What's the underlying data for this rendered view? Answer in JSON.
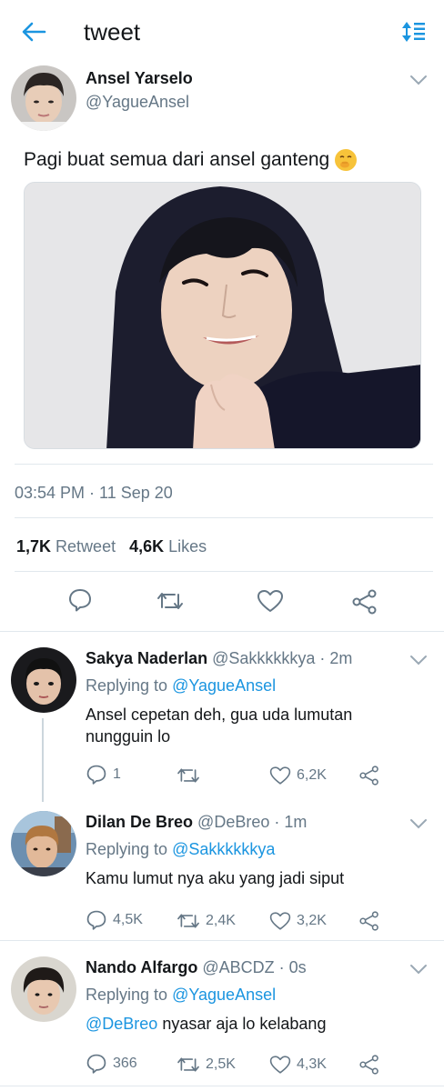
{
  "header": {
    "title": "tweet"
  },
  "main_tweet": {
    "name": "Ansel Yarselo",
    "handle": "@YagueAnsel",
    "text": "Pagi buat semua dari ansel ganteng",
    "timestamp": "03:54 PM · 11 Sep 20",
    "retweets_count": "1,7K",
    "retweets_label": "Retweet",
    "likes_count": "4,6K",
    "likes_label": "Likes"
  },
  "replies": [
    {
      "name": "Sakya Naderlan",
      "handle": "@Sakkkkkkya",
      "time": "· 2m",
      "replying_prefix": "Replying to",
      "replying_to": "@YagueAnsel",
      "text": "Ansel cepetan deh, gua uda lumutan nungguin lo",
      "reply_count": "1",
      "retweet_count": "",
      "like_count": "6,2K"
    },
    {
      "name": "Dilan De Breo",
      "handle": "@DeBreo",
      "time": "· 1m",
      "replying_prefix": "Replying to",
      "replying_to": "@Sakkkkkkya",
      "text": "Kamu lumut nya aku yang jadi siput",
      "reply_count": "4,5K",
      "retweet_count": "2,4K",
      "like_count": "3,2K"
    },
    {
      "name": "Nando Alfargo",
      "handle": "@ABCDZ",
      "time": "· 0s",
      "replying_prefix": "Replying to",
      "replying_to": "@YagueAnsel",
      "mention": "@DeBreo",
      "text": "nyasar aja lo kelabang",
      "reply_count": "366",
      "retweet_count": "2,5K",
      "like_count": "4,3K"
    }
  ],
  "colors": {
    "accent": "#1b95e0",
    "muted": "#657786",
    "text": "#14171a",
    "divider": "#e1e8ed"
  },
  "icons": [
    "back-arrow-icon",
    "sort-icon",
    "chevron-down-icon",
    "reply-icon",
    "retweet-icon",
    "like-icon",
    "share-icon",
    "emoji-icon"
  ]
}
